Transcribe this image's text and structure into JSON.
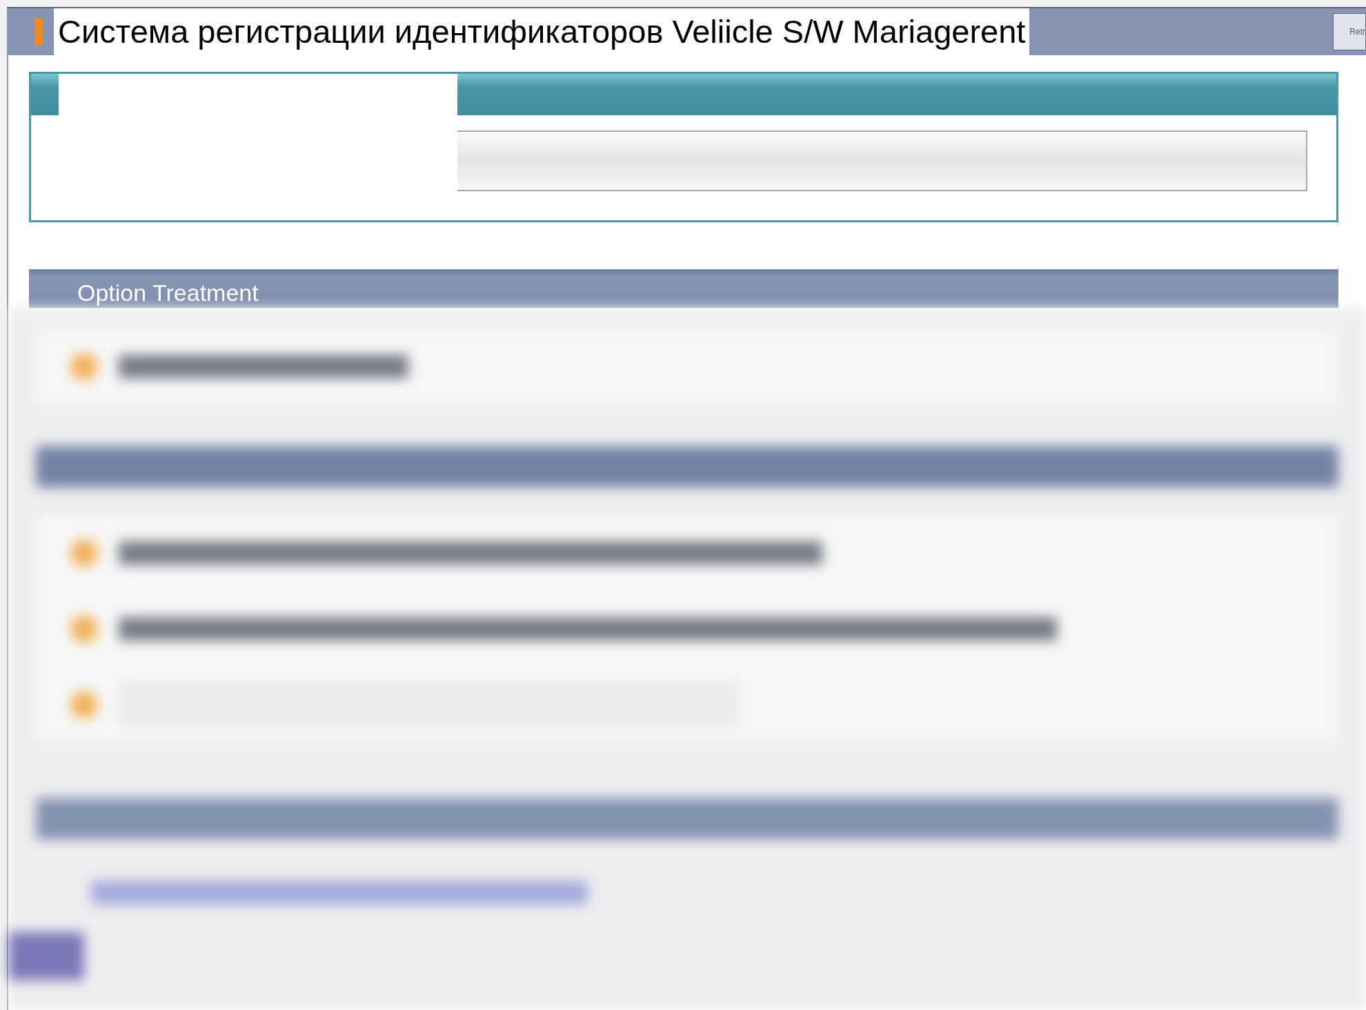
{
  "window": {
    "title": "Система регистрации идентификаторов Veliicle S/W Mariagerent",
    "corner_button": "Retr"
  },
  "sections": [
    {
      "title": "Option Treatment"
    }
  ]
}
